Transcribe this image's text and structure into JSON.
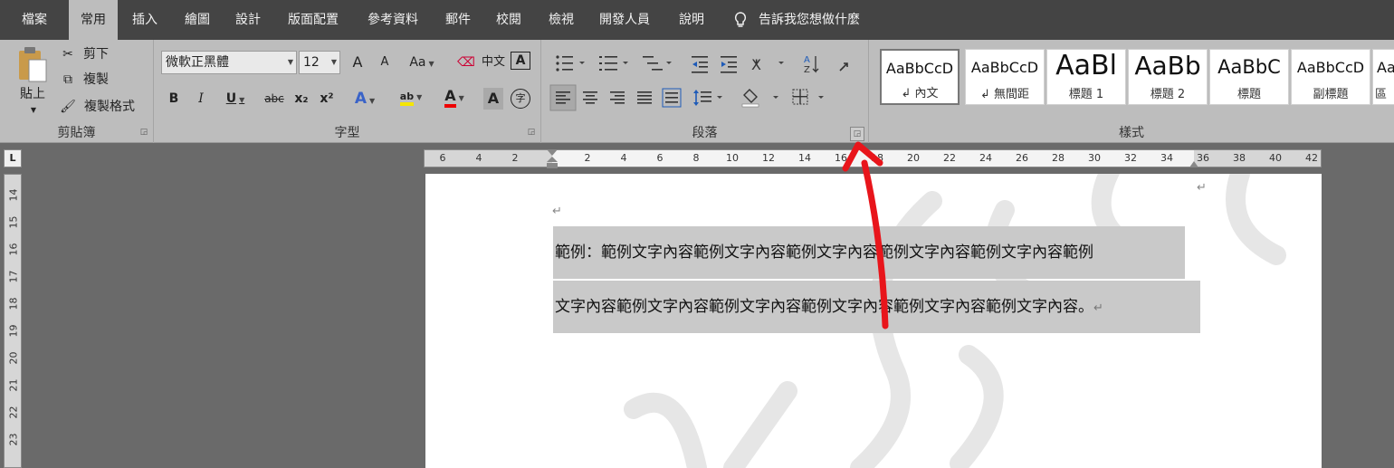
{
  "tabs": [
    "檔案",
    "常用",
    "插入",
    "繪圖",
    "設計",
    "版面配置",
    "參考資料",
    "郵件",
    "校閱",
    "檢視",
    "開發人員",
    "說明"
  ],
  "tell_me": "告訴我您想做什麼",
  "clipboard": {
    "paste": "貼上",
    "cut": "剪下",
    "copy": "複製",
    "format_painter": "複製格式",
    "label": "剪貼簿"
  },
  "font": {
    "name": "微軟正黑體",
    "size": "12",
    "label": "字型",
    "grow": "A",
    "shrink": "A",
    "case": "Aa",
    "phonetic": "中文",
    "border_char": "A",
    "bold": "B",
    "italic": "I",
    "underline": "U",
    "strike": "abc",
    "sub": "x₂",
    "sup": "x²",
    "effects": "A",
    "highlight": "ab",
    "color": "A",
    "shading": "A",
    "enclose": "字"
  },
  "paragraph": {
    "label": "段落",
    "sort": "A↓Z"
  },
  "styles": {
    "label": "樣式",
    "items": [
      {
        "preview": "AaBbCcD",
        "name": "↲ 內文"
      },
      {
        "preview": "AaBbCcD",
        "name": "↲ 無間距"
      },
      {
        "preview": "AaBl",
        "name": "標題 1"
      },
      {
        "preview": "AaBb",
        "name": "標題 2"
      },
      {
        "preview": "AaBbC",
        "name": "標題"
      },
      {
        "preview": "AaBbCcD",
        "name": "副標題"
      },
      {
        "preview": "Aa",
        "name": "區"
      }
    ]
  },
  "ruler": {
    "h": [
      "6",
      "4",
      "2",
      "",
      "2",
      "4",
      "6",
      "8",
      "10",
      "12",
      "14",
      "16",
      "18",
      "20",
      "22",
      "24",
      "26",
      "28",
      "30",
      "32",
      "34",
      "36",
      "38",
      "40",
      "42"
    ],
    "v": [
      "14",
      "15",
      "16",
      "17",
      "18",
      "19",
      "20",
      "21",
      "22",
      "23"
    ],
    "tab_selector": "L"
  },
  "document": {
    "line1": "範例：範例文字內容範例文字內容範例文字內容範例文字內容範例文字內容範例",
    "line2": "文字內容範例文字內容範例文字內容範例文字內容範例文字內容範例文字內容。",
    "para_mark": "↵"
  }
}
